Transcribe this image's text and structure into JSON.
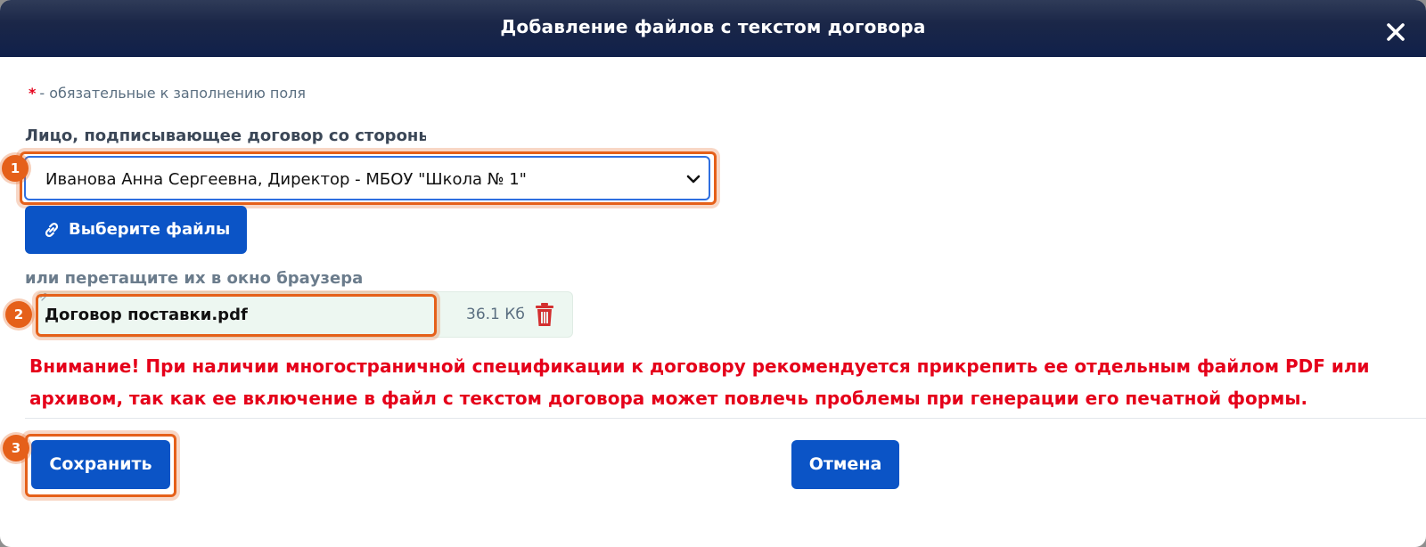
{
  "dialog": {
    "title": "Добавление файлов с текстом договора"
  },
  "form": {
    "required_star": "*",
    "required_note": "- обязательные к заполнению поля",
    "signer_label": "Лицо, подписывающее договор со стороны",
    "signer_value": "Иванова Анна Сергеевна, Директор - МБОУ \"Школа № 1\"",
    "choose_files_label": "Выберите файлы",
    "drop_hint": "или перетащите их в окно браузера"
  },
  "file": {
    "name": "Договор поставки.pdf",
    "size": "36.1 Кб"
  },
  "warning_text": "Внимание! При наличии многостраничной спецификации к договору рекомендуется прикрепить ее отдельным файлом PDF или архивом, так как ее включение в файл с текстом договора может повлечь проблемы при генерации его печатной формы.",
  "buttons": {
    "save": "Сохранить",
    "cancel": "Отмена"
  },
  "badges": [
    "1",
    "2",
    "3"
  ],
  "colors": {
    "title_bar": "#10204a",
    "primary": "#0b54c6",
    "warning": "#e5001a",
    "highlight": "#e5601a"
  }
}
